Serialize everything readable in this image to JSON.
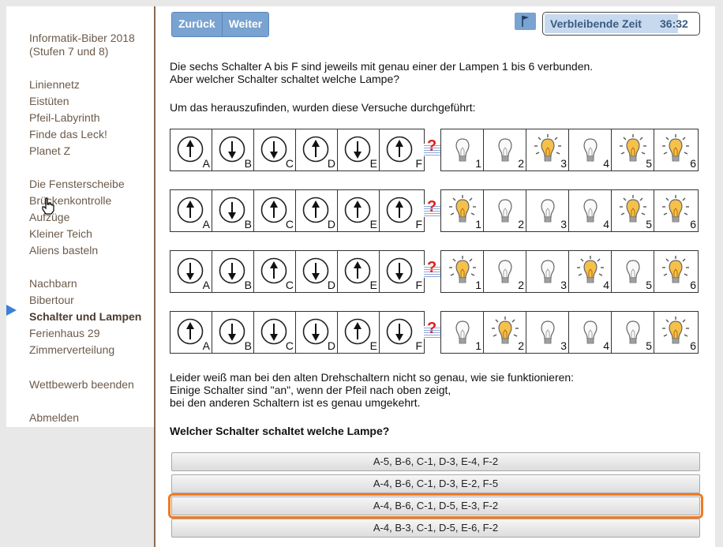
{
  "sidebar": {
    "title_line1": "Informatik-Biber 2018",
    "title_line2": "(Stufen 7 und 8)",
    "groups": [
      [
        "Liniennetz",
        "Eistüten",
        "Pfeil-Labyrinth",
        "Finde das Leck!",
        "Planet Z"
      ],
      [
        "Die Fensterscheibe",
        "Brückenkontrolle",
        "Aufzüge",
        "Kleiner Teich",
        "Aliens basteln"
      ],
      [
        "Nachbarn",
        "Bibertour",
        "Schalter und Lampen",
        "Ferienhaus 29",
        "Zimmerverteilung"
      ],
      [
        "Wettbewerb beenden"
      ],
      [
        "Abmelden"
      ]
    ],
    "active_item": "Schalter und Lampen"
  },
  "nav": {
    "back_label": "Zurück",
    "next_label": "Weiter"
  },
  "timer": {
    "label": "Verbleibende Zeit",
    "value": "36:32",
    "remaining_fraction": 0.92
  },
  "text": {
    "intro1": "Die sechs Schalter A bis F sind jeweils mit genau einer der Lampen 1 bis 6 verbunden.",
    "intro2": "Aber welcher Schalter schaltet welche Lampe?",
    "intro3": "Um das herauszufinden, wurden diese Versuche durchgeführt:",
    "note1": "Leider weiß man bei den alten Drehschaltern nicht so genau, wie sie funktionieren:",
    "note2": "Einige Schalter sind \"an\", wenn der Pfeil nach oben zeigt,",
    "note3": "bei den anderen Schaltern ist es genau umgekehrt.",
    "question": "Welcher Schalter schaltet welche Lampe?",
    "question_mark": "?"
  },
  "switch_labels": [
    "A",
    "B",
    "C",
    "D",
    "E",
    "F"
  ],
  "lamp_labels": [
    "1",
    "2",
    "3",
    "4",
    "5",
    "6"
  ],
  "experiments": [
    {
      "switches": [
        "up",
        "down",
        "down",
        "up",
        "down",
        "up"
      ],
      "lamps": [
        false,
        false,
        true,
        false,
        true,
        true
      ]
    },
    {
      "switches": [
        "up",
        "down",
        "up",
        "up",
        "up",
        "up"
      ],
      "lamps": [
        true,
        false,
        false,
        false,
        true,
        true
      ]
    },
    {
      "switches": [
        "down",
        "down",
        "up",
        "down",
        "up",
        "down"
      ],
      "lamps": [
        true,
        false,
        false,
        true,
        false,
        true
      ]
    },
    {
      "switches": [
        "up",
        "down",
        "down",
        "down",
        "up",
        "down"
      ],
      "lamps": [
        false,
        true,
        false,
        false,
        false,
        true
      ]
    }
  ],
  "answers": [
    "A-5, B-6, C-1, D-3, E-4, F-2",
    "A-4, B-6, C-1, D-3, E-2, F-5",
    "A-4, B-6, C-1, D-5, E-3, F-2",
    "A-4, B-3, C-1, D-5, E-6, F-2"
  ],
  "selected_answer": 2,
  "colors": {
    "accent": "#79a3d0",
    "highlight": "#f07a20",
    "bulb_on": "#f5c14a",
    "sidebar_link": "#6b5a4a"
  }
}
